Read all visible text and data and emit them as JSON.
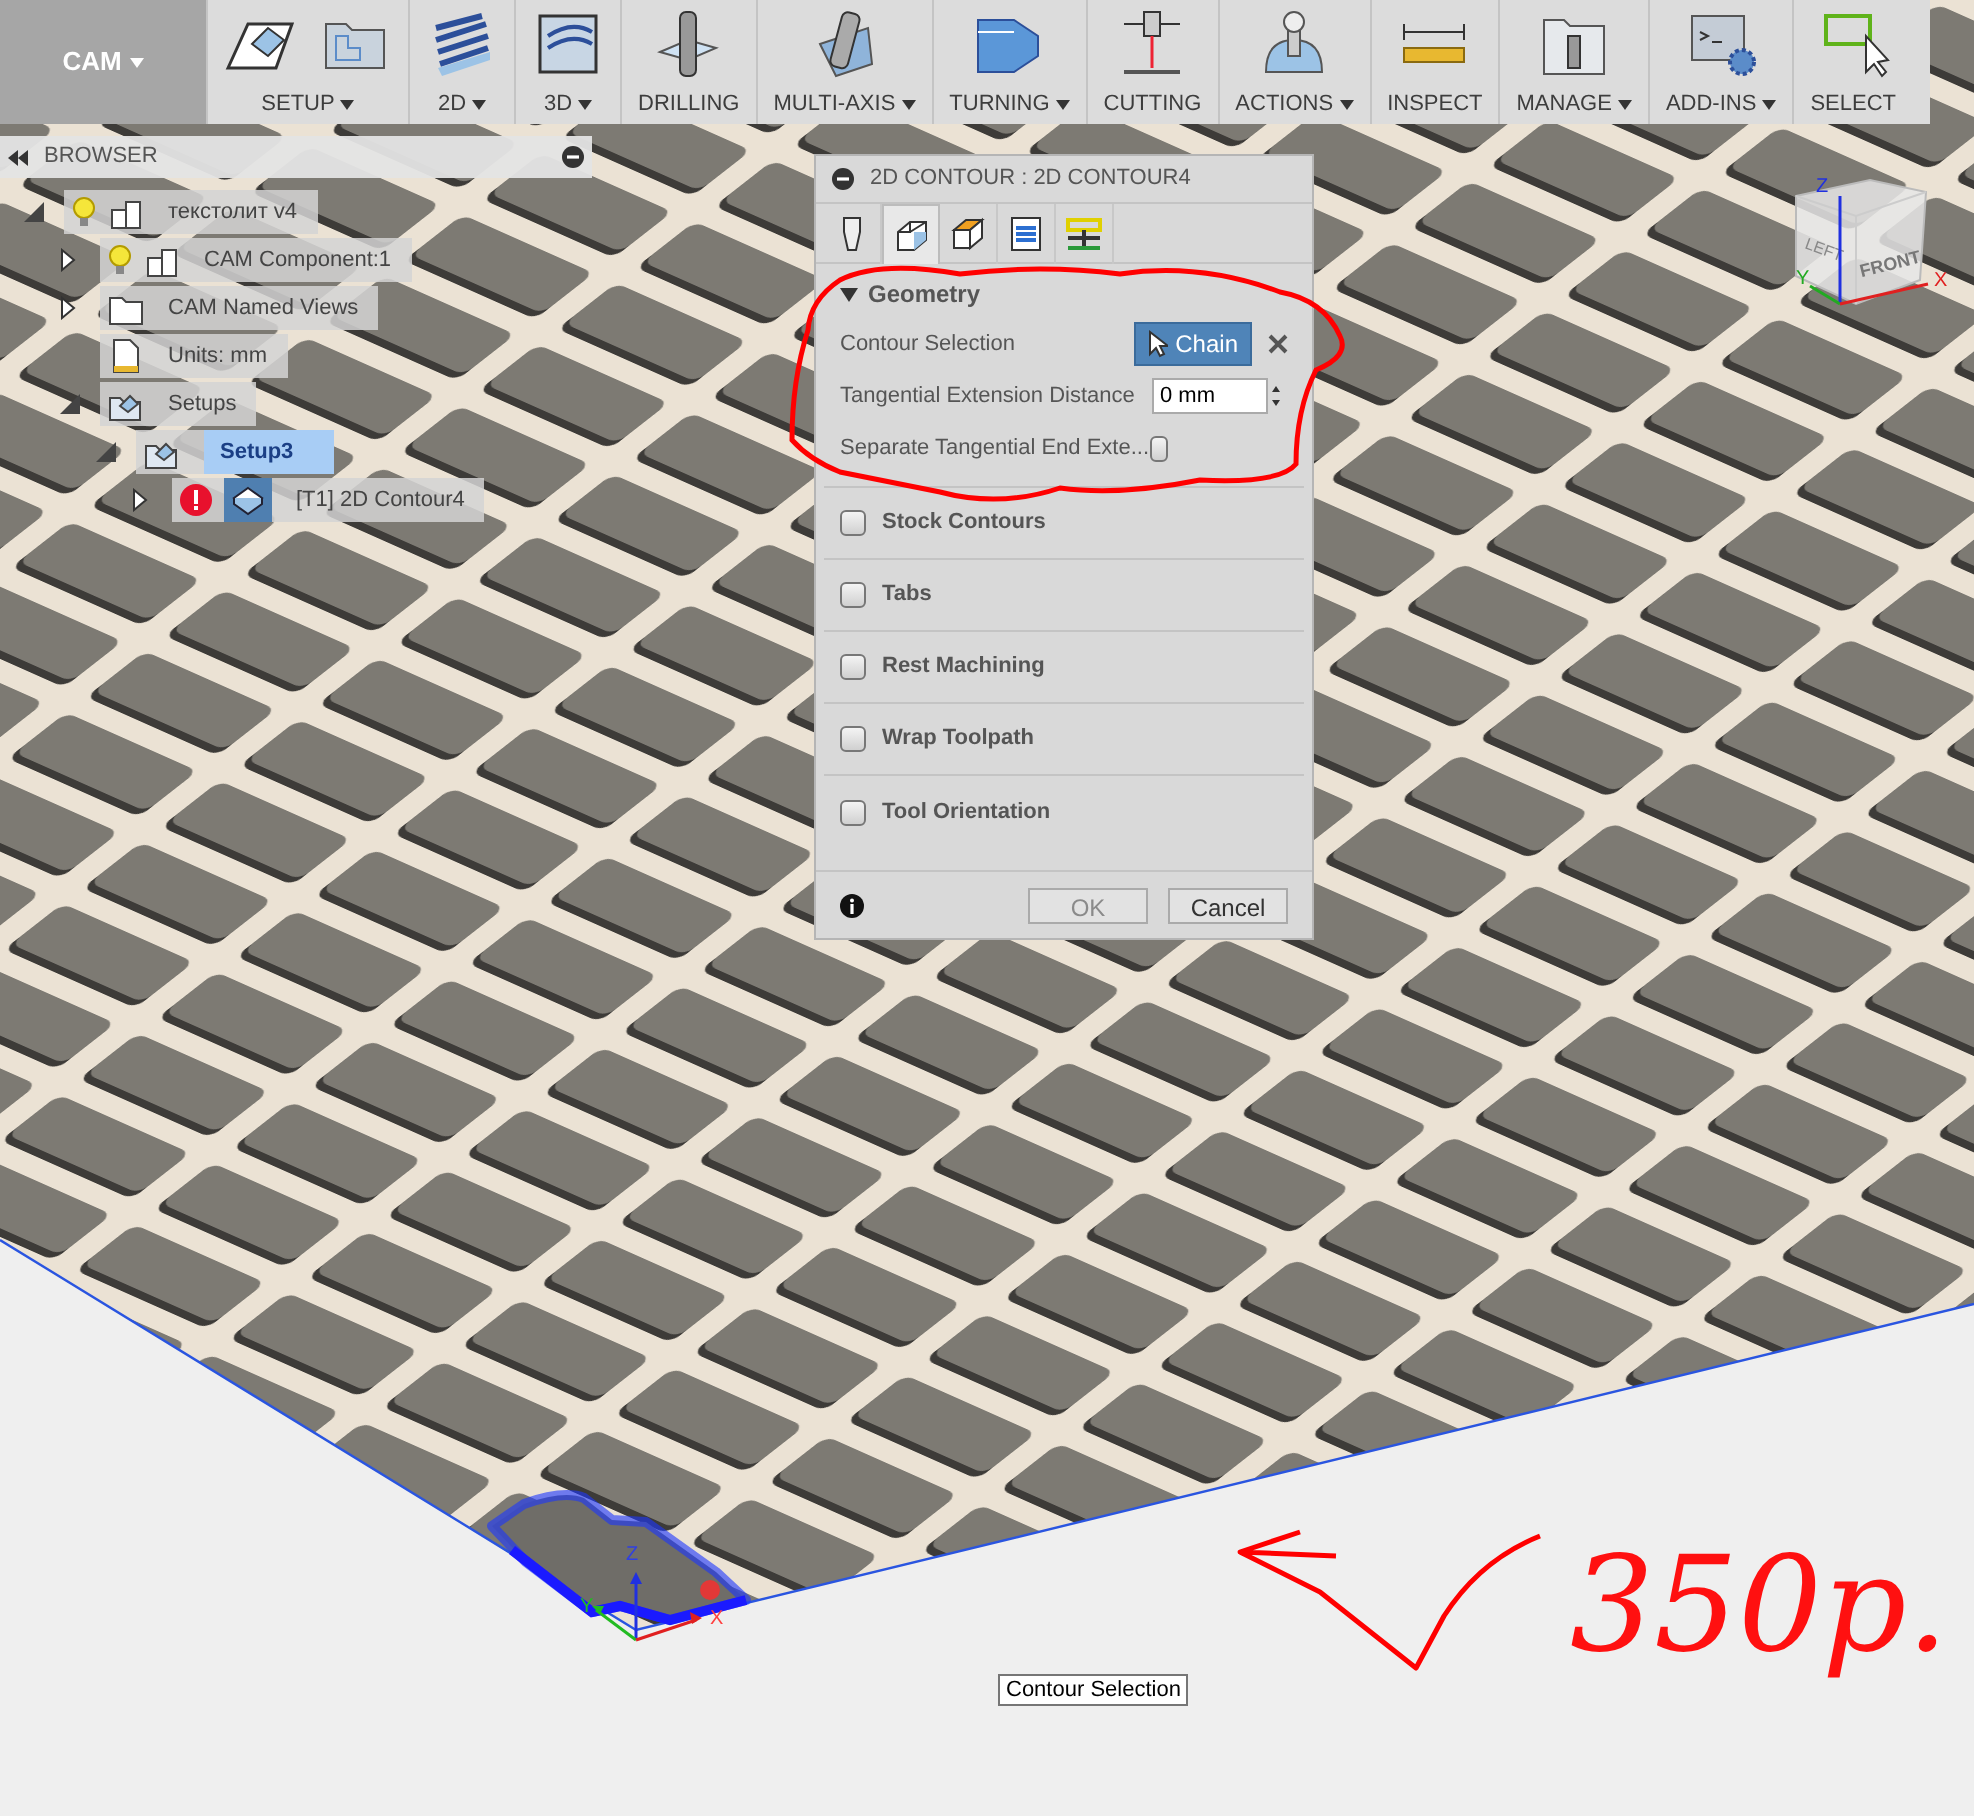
{
  "toolbar": {
    "workspace": {
      "label": "CAM",
      "dropdown": true
    },
    "groups": [
      {
        "label": "SETUP",
        "dropdown": true
      },
      {
        "label": "2D",
        "dropdown": true
      },
      {
        "label": "3D",
        "dropdown": true
      },
      {
        "label": "DRILLING",
        "dropdown": false
      },
      {
        "label": "MULTI-AXIS",
        "dropdown": true
      },
      {
        "label": "TURNING",
        "dropdown": true
      },
      {
        "label": "CUTTING",
        "dropdown": false
      },
      {
        "label": "ACTIONS",
        "dropdown": true
      },
      {
        "label": "INSPECT",
        "dropdown": false
      },
      {
        "label": "MANAGE",
        "dropdown": true
      },
      {
        "label": "ADD-INS",
        "dropdown": true
      },
      {
        "label": "SELECT",
        "dropdown": false
      }
    ]
  },
  "browser": {
    "title": "BROWSER",
    "tree": [
      {
        "label": "текстолит v4",
        "kind": "component",
        "visible": true,
        "expanded": true,
        "selected": false,
        "error": false,
        "children": [
          {
            "label": "CAM Component:1",
            "kind": "component",
            "visible": true,
            "expanded": false,
            "selected": false,
            "error": false
          },
          {
            "label": "CAM Named Views",
            "kind": "folder",
            "expanded": false,
            "selected": false,
            "error": false
          },
          {
            "label": "Units: mm",
            "kind": "units",
            "selected": false,
            "error": false
          },
          {
            "label": "Setups",
            "kind": "setups",
            "expanded": true,
            "selected": false,
            "error": false,
            "children": [
              {
                "label": "Setup3",
                "kind": "setup",
                "expanded": true,
                "selected": true,
                "error": false,
                "children": [
                  {
                    "label": "[T1] 2D Contour4",
                    "kind": "operation",
                    "expanded": false,
                    "selected": false,
                    "error": true
                  }
                ]
              }
            ]
          }
        ]
      }
    ]
  },
  "dialog": {
    "title": "2D CONTOUR : 2D CONTOUR4",
    "tabs": [
      {
        "selected": false
      },
      {
        "selected": true
      },
      {
        "selected": false
      },
      {
        "selected": false
      },
      {
        "selected": false
      }
    ],
    "geometry": {
      "title": "Geometry",
      "expanded": true,
      "rows": [
        {
          "kind": "selection",
          "label": "Contour Selection",
          "button": "Chain"
        },
        {
          "kind": "number",
          "label": "Tangential Extension Distance",
          "value": "0 mm"
        },
        {
          "kind": "checkbox",
          "label": "Separate Tangential End Exte...",
          "checked": false
        }
      ]
    },
    "sections": [
      {
        "title": "Stock Contours",
        "checked": false
      },
      {
        "title": "Tabs",
        "checked": false
      },
      {
        "title": "Rest Machining",
        "checked": false
      },
      {
        "title": "Wrap Toolpath",
        "checked": false
      },
      {
        "title": "Tool Orientation",
        "checked": false
      }
    ],
    "buttons": [
      {
        "label": "OK",
        "disabled": true
      },
      {
        "label": "Cancel",
        "disabled": false
      }
    ]
  },
  "view_cube": {
    "faces": [
      "FRONT",
      "LEFT"
    ],
    "axes": [
      "Z",
      "Y",
      "X"
    ]
  },
  "triad": {
    "axes": [
      "Z",
      "Y",
      "X"
    ]
  },
  "tooltip": "Contour Selection",
  "annotation": {
    "note": "350р."
  }
}
